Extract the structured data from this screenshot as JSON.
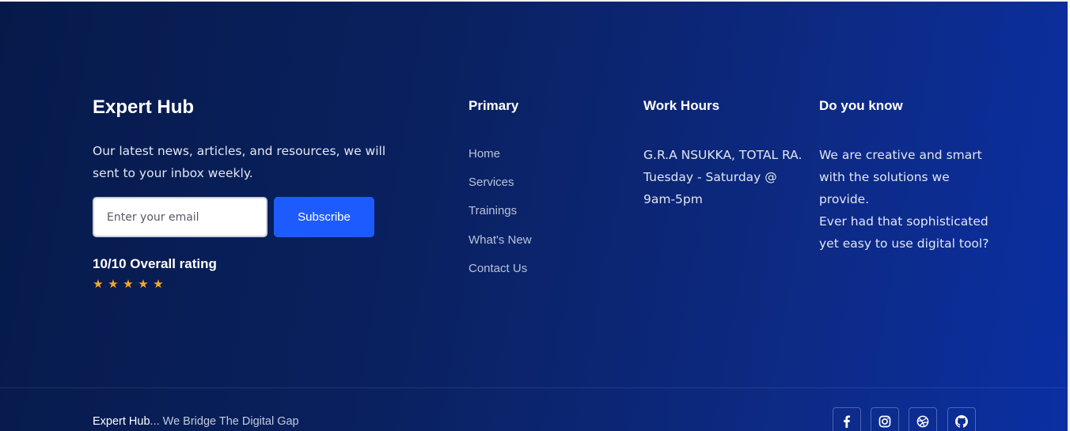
{
  "brand": {
    "title": "Expert Hub",
    "description": "Our latest news, articles, and resources, we will sent to your inbox weekly."
  },
  "newsletter": {
    "email_placeholder": "Enter your email",
    "subscribe_label": "Subscribe"
  },
  "rating": {
    "text": "10/10 Overall rating",
    "stars": 5,
    "star_color": "#f7a928"
  },
  "primary": {
    "heading": "Primary",
    "links": [
      "Home",
      "Services",
      "Trainings",
      "What's New",
      "Contact Us"
    ]
  },
  "work_hours": {
    "heading": "Work Hours",
    "address": "G.R.A NSUKKA, TOTAL RA.",
    "schedule": "Tuesday - Saturday @ 9am-5pm"
  },
  "do_you_know": {
    "heading": "Do you know",
    "line1": "We are creative and smart with the solutions we provide.",
    "line2": "Ever had that sophisticated yet easy to use digital tool?"
  },
  "bottom": {
    "brand": "Expert Hub",
    "tagline": "... We Bridge The Digital Gap"
  },
  "social_icons": [
    "facebook-icon",
    "instagram-icon",
    "dribbble-icon",
    "github-icon"
  ],
  "colors": {
    "accent": "#1e5bff",
    "background_start": "#061a4a",
    "background_end": "#0a2fa2"
  }
}
